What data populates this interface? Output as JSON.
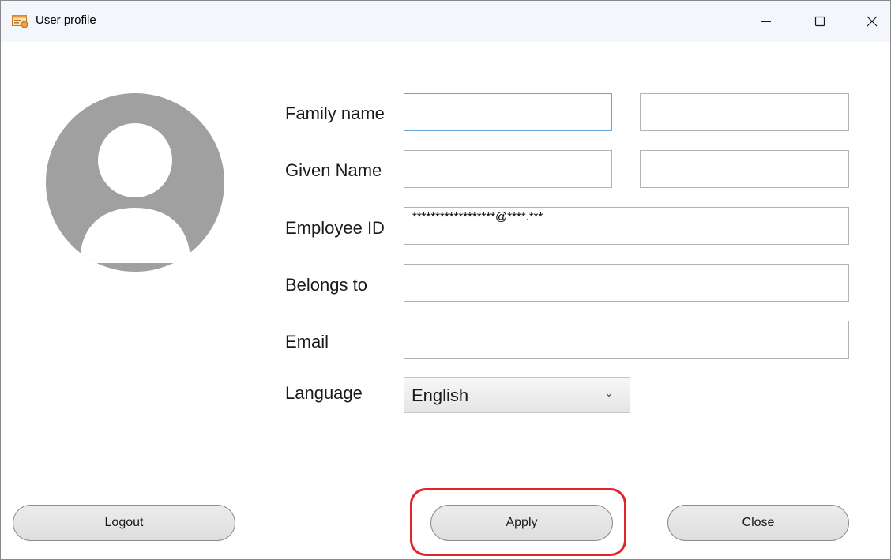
{
  "window": {
    "title": "User profile",
    "icon": "app-window-icon",
    "controls": [
      "minimize-icon",
      "maximize-icon",
      "close-icon"
    ]
  },
  "avatar": {
    "icon": "user-avatar-icon",
    "color": "#a0a0a0"
  },
  "form": {
    "family_name": {
      "label": "Family name",
      "value_1": "",
      "value_2": ""
    },
    "given_name": {
      "label": "Given Name",
      "value_1": "",
      "value_2": ""
    },
    "employee_id": {
      "label": "Employee ID",
      "value": "******************@****.***"
    },
    "belongs_to": {
      "label": "Belongs to",
      "value": ""
    },
    "email": {
      "label": "Email",
      "value": ""
    },
    "language": {
      "label": "Language",
      "selected": "English"
    }
  },
  "buttons": {
    "logout": "Logout",
    "apply": "Apply",
    "close": "Close"
  },
  "colors": {
    "focus_border": "#6aa3d8",
    "highlight": "#e0242a"
  }
}
